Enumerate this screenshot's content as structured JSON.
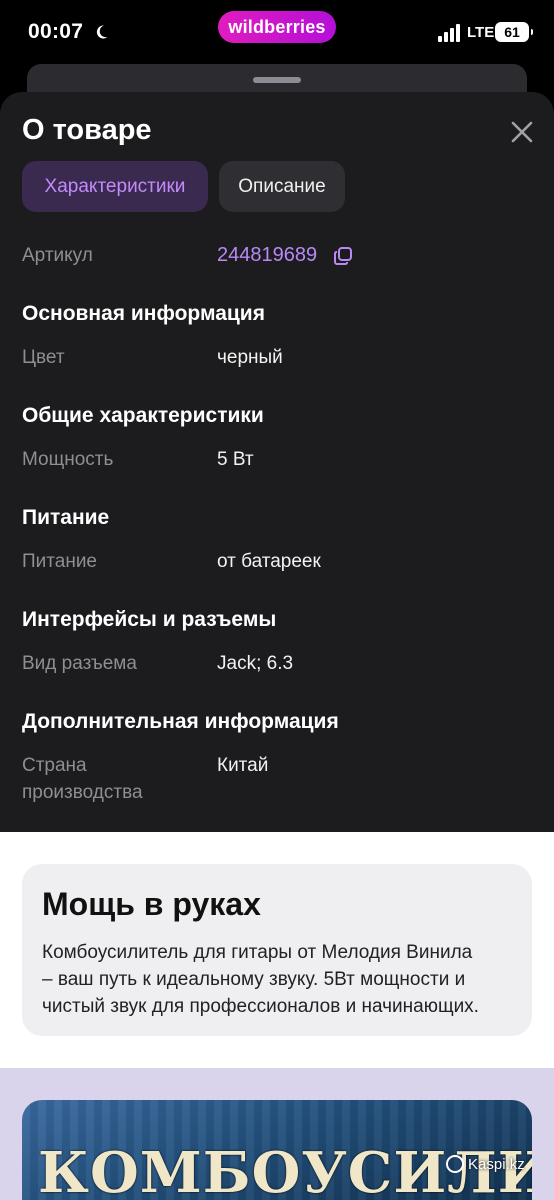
{
  "status_bar": {
    "time": "00:07",
    "network": "LTE",
    "battery": "61",
    "logo": "wildberries"
  },
  "sheet": {
    "title": "О товаре",
    "tabs": [
      {
        "label": "Характеристики",
        "active": true
      },
      {
        "label": "Описание",
        "active": false
      }
    ],
    "article_label": "Артикул",
    "article_value": "244819689",
    "sections": [
      {
        "heading": "Основная информация",
        "rows": [
          {
            "label": "Цвет",
            "value": "черный"
          }
        ]
      },
      {
        "heading": "Общие характеристики",
        "rows": [
          {
            "label": "Мощность",
            "value": "5 Вт"
          }
        ]
      },
      {
        "heading": "Питание",
        "rows": [
          {
            "label": "Питание",
            "value": "от батареек"
          }
        ]
      },
      {
        "heading": "Интерфейсы и разъемы",
        "rows": [
          {
            "label": "Вид разъема",
            "value": "Jack; 6.3"
          }
        ]
      },
      {
        "heading": "Дополнительная информация",
        "rows": [
          {
            "label_line1": "Страна",
            "label_line2": "производства",
            "value": "Китай"
          }
        ]
      }
    ]
  },
  "promo": {
    "title": "Мощь в руках",
    "text_line1": "Комбоусилитель для гитары от Мелодия Винила",
    "text_line2": "– ваш путь к идеальному звуку. 5Вт мощности и",
    "text_line3": "чистый звук для профессионалов и начинающих."
  },
  "image": {
    "text": "КОМБОУСИЛИТЕЛЬ"
  },
  "watermark": "Kaspi.kz",
  "colors": {
    "sheet_bg": "#1c1c1e",
    "accent_purple": "#c38afa",
    "wb_brand": "#cb11ab"
  }
}
